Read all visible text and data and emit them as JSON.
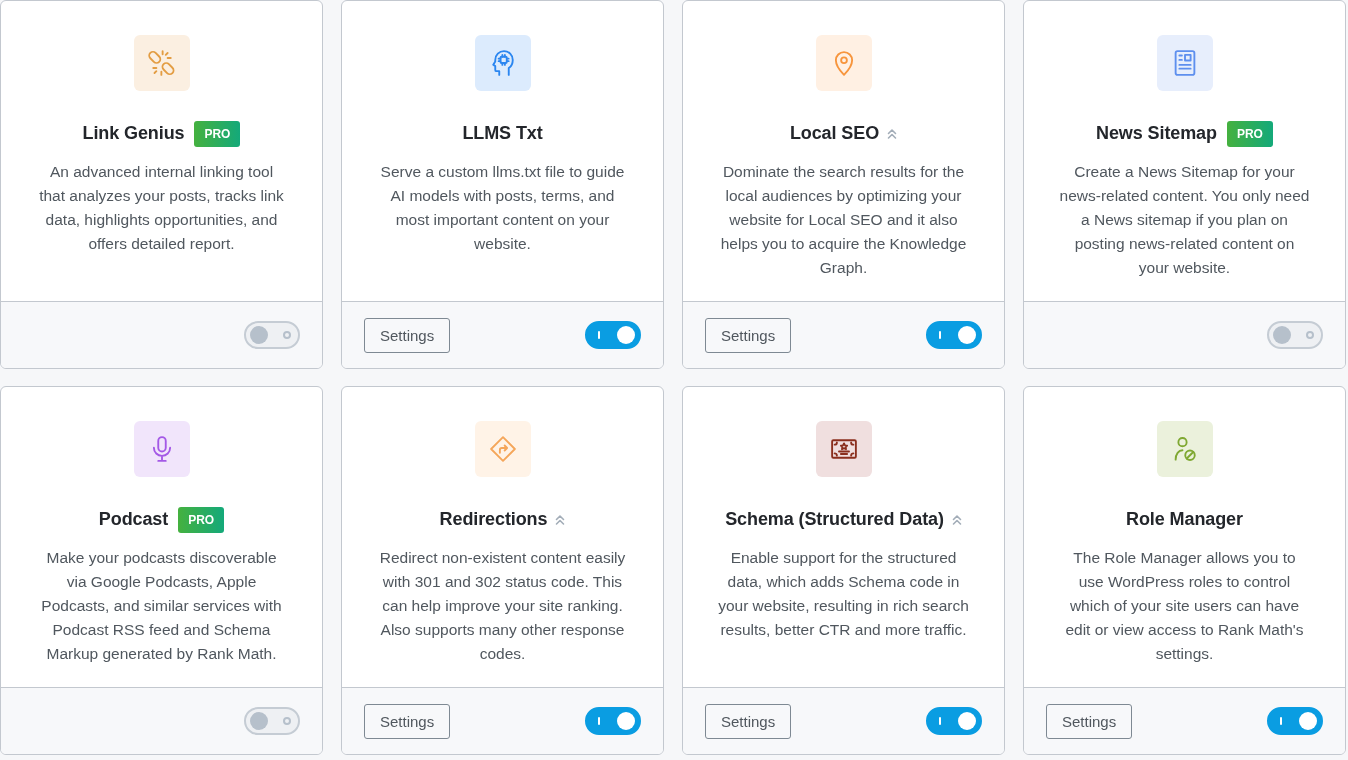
{
  "modules": [
    {
      "title": "Link Genius",
      "badge": "PRO",
      "chevron": false,
      "description": "An advanced internal linking tool that analyzes your posts, tracks link data, highlights opportunities, and offers detailed report.",
      "on": false
    },
    {
      "title": "LLMS Txt",
      "chevron": false,
      "description": "Serve a custom llms.txt file to guide AI models with posts, terms, and most important content on your website.",
      "settings_button": "Settings",
      "on": true
    },
    {
      "title": "Local SEO",
      "chevron": true,
      "description": "Dominate the search results for the local audiences by optimizing your website for Local SEO and it also helps you to acquire the Knowledge Graph.",
      "settings_button": "Settings",
      "on": true
    },
    {
      "title": "News Sitemap",
      "badge": "PRO",
      "chevron": false,
      "description": "Create a News Sitemap for your news-related content. You only need a News sitemap if you plan on posting news-related content on your website.",
      "on": false
    },
    {
      "title": "Podcast",
      "badge": "PRO",
      "chevron": false,
      "description": "Make your podcasts discoverable via Google Podcasts, Apple Podcasts, and similar services with Podcast RSS feed and Schema Markup generated by Rank Math.",
      "on": false
    },
    {
      "title": "Redirections",
      "chevron": true,
      "description": "Redirect non-existent content easily with 301 and 302 status code. This can help improve your site ranking. Also supports many other response codes.",
      "settings_button": "Settings",
      "on": true
    },
    {
      "title": "Schema (Structured Data)",
      "chevron": true,
      "description": "Enable support for the structured data, which adds Schema code in your website, resulting in rich search results, better CTR and more traffic.",
      "settings_button": "Settings",
      "on": true
    },
    {
      "title": "Role Manager",
      "chevron": false,
      "description": "The Role Manager allows you to use WordPress roles to control which of your site users can have edit or view access to Rank Math's settings.",
      "settings_button": "Settings",
      "on": true
    }
  ]
}
